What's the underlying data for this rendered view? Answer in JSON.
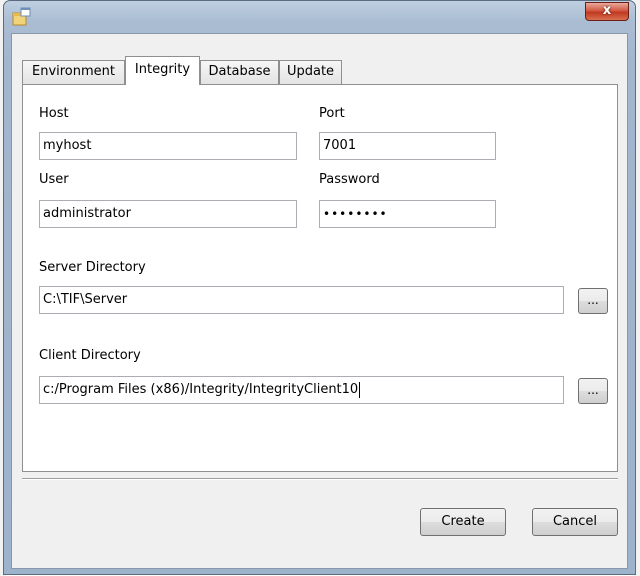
{
  "window": {
    "close_glyph": "x"
  },
  "tabs": [
    {
      "label": "Environment"
    },
    {
      "label": "Integrity"
    },
    {
      "label": "Database"
    },
    {
      "label": "Update"
    }
  ],
  "active_tab": "Integrity",
  "form": {
    "host_label": "Host",
    "host_value": "myhost",
    "port_label": "Port",
    "port_value": "7001",
    "user_label": "User",
    "user_value": "administrator",
    "password_label": "Password",
    "password_value": "••••••••",
    "server_dir_label": "Server Directory",
    "server_dir_value": "C:\\TIF\\Server",
    "client_dir_label": "Client Directory",
    "client_dir_value": "c:/Program Files (x86)/Integrity/IntegrityClient10",
    "browse_label": "..."
  },
  "buttons": {
    "create": "Create",
    "cancel": "Cancel"
  },
  "colors": {
    "close_button": "#c74a33",
    "title_bar": "#a9bdd3"
  },
  "icons": {
    "app": "app-window-icon",
    "close": "close-icon"
  }
}
